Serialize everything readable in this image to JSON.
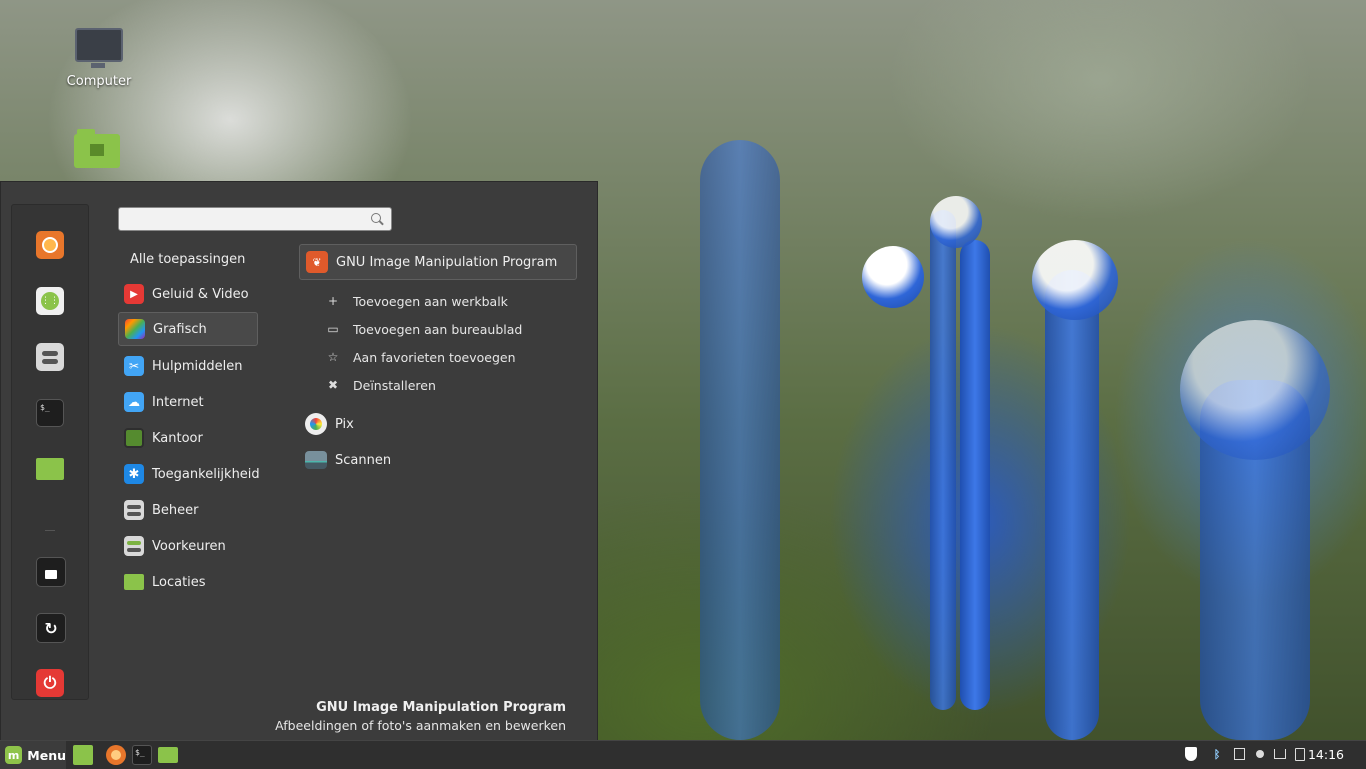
{
  "desktop": {
    "icons": [
      {
        "label": "Computer",
        "icon": "computer-icon"
      },
      {
        "label": "",
        "icon": "home-folder-icon"
      }
    ]
  },
  "menu": {
    "search": {
      "value": "",
      "placeholder": ""
    },
    "favorites": [
      {
        "name": "firefox-icon",
        "color": "#e8762b"
      },
      {
        "name": "software-manager-icon",
        "color": "#8bc34a"
      },
      {
        "name": "settings-icon",
        "color": "#d9d9d9"
      },
      {
        "name": "terminal-icon",
        "color": "#1e1e1e"
      },
      {
        "name": "files-folder-icon",
        "color": "#8bc34a"
      },
      {
        "name": "lock-icon",
        "color": "#1e1e1e"
      },
      {
        "name": "logout-icon",
        "color": "#1e1e1e"
      },
      {
        "name": "power-icon",
        "color": "#e53935"
      }
    ],
    "categories_header": "Alle toepassingen",
    "categories": [
      {
        "label": "Geluid & Video",
        "icon": "play-icon",
        "color": "#e53935"
      },
      {
        "label": "Grafisch",
        "icon": "graphics-icon",
        "color": "#9c27b0"
      },
      {
        "label": "Hulpmiddelen",
        "icon": "scissors-icon",
        "color": "#42a5f5"
      },
      {
        "label": "Internet",
        "icon": "cloud-icon",
        "color": "#42a5f5"
      },
      {
        "label": "Kantoor",
        "icon": "office-icon",
        "color": "#558b2f"
      },
      {
        "label": "Toegankelijkheid",
        "icon": "accessibility-icon",
        "color": "#1e88e5"
      },
      {
        "label": "Beheer",
        "icon": "admin-icon",
        "color": "#d9d9d9"
      },
      {
        "label": "Voorkeuren",
        "icon": "preferences-icon",
        "color": "#d9d9d9"
      },
      {
        "label": "Locaties",
        "icon": "folder-icon",
        "color": "#8bc34a"
      }
    ],
    "apps": [
      {
        "label": "GNU Image Manipulation Program",
        "icon": "gimp-icon",
        "color": "#e05a2b"
      },
      {
        "label": "Pix",
        "icon": "pix-icon",
        "color": "#eeeeee"
      },
      {
        "label": "Scannen",
        "icon": "scanner-icon",
        "color": "#607d8b"
      }
    ],
    "context_menu": [
      {
        "symbol": "+",
        "label": "Toevoegen aan werkbalk"
      },
      {
        "symbol": "▭",
        "label": "Toevoegen aan bureaublad"
      },
      {
        "symbol": "☆",
        "label": "Aan favorieten toevoegen"
      },
      {
        "symbol": "✖",
        "label": "Deïnstalleren"
      }
    ],
    "description": {
      "title": "GNU Image Manipulation Program",
      "text": "Afbeeldingen of foto's aanmaken en bewerken"
    }
  },
  "taskbar": {
    "menu_label": "Menu",
    "clock": "14:16"
  }
}
